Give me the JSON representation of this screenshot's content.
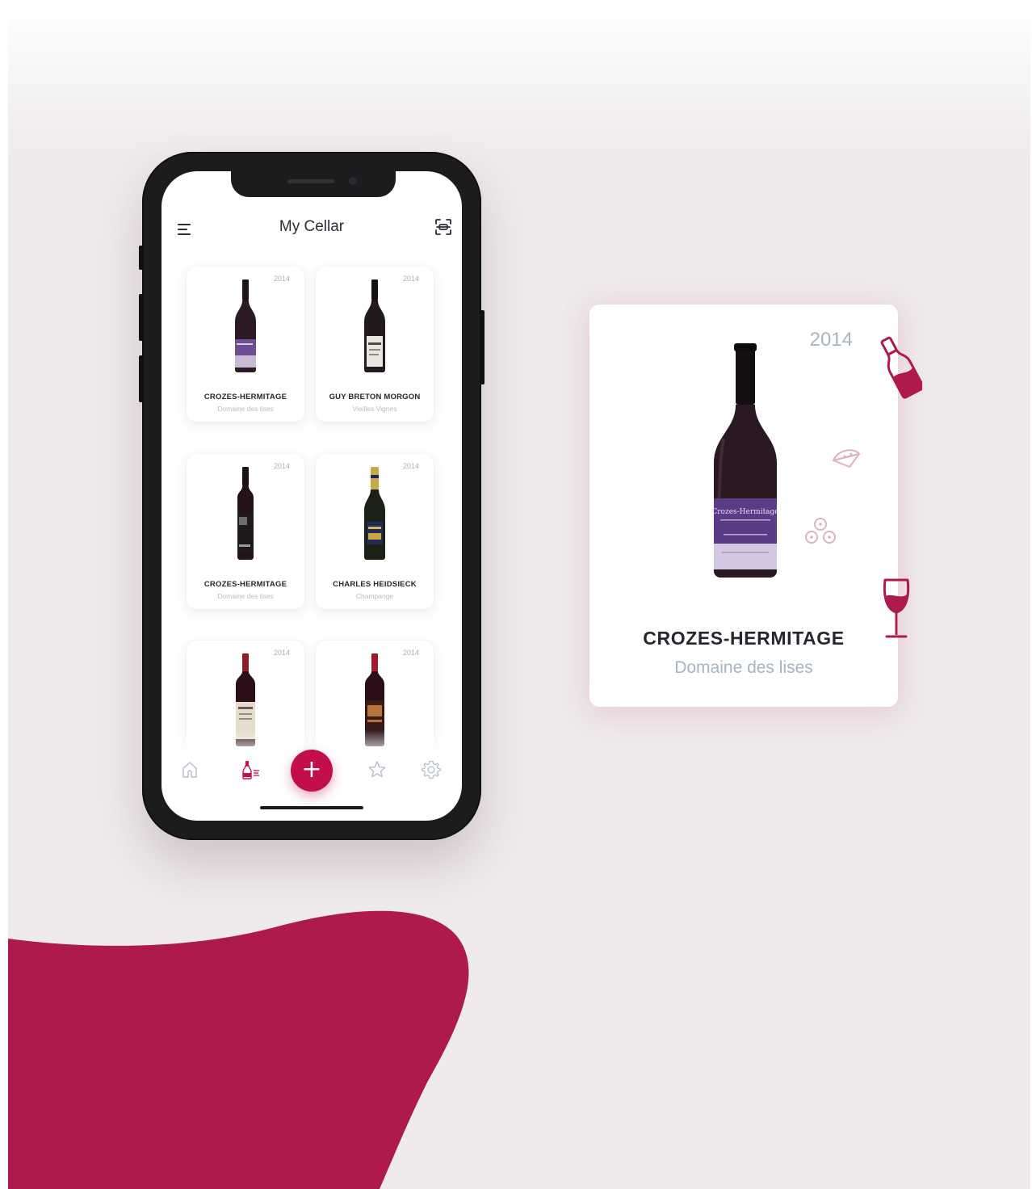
{
  "app": {
    "title": "My Cellar"
  },
  "colors": {
    "accent": "#c20f49",
    "blob": "#ad1a4b",
    "background": "#efeaec"
  },
  "wines": [
    {
      "year": "2014",
      "name": "CROZES-HERMITAGE",
      "subtitle": "Domaine des lises",
      "bottle": "red-purple-label"
    },
    {
      "year": "2014",
      "name": "GUY BRETON MORGON",
      "subtitle": "Vieilles Vignes",
      "bottle": "red-white-label"
    },
    {
      "year": "2014",
      "name": "CROZES-HERMITAGE",
      "subtitle": "Domaine des lises",
      "bottle": "bordeaux-dark-label"
    },
    {
      "year": "2014",
      "name": "CHARLES HEIDSIECK",
      "subtitle": "Champange",
      "bottle": "champagne-gold-foil"
    },
    {
      "year": "2014",
      "name": "",
      "subtitle": "",
      "bottle": "red-cream-label"
    },
    {
      "year": "2014",
      "name": "",
      "subtitle": "",
      "bottle": "red-copper-label"
    }
  ],
  "tabbar": {
    "items": [
      "home-icon",
      "cellar-list-icon",
      "add-icon",
      "star-icon",
      "settings-icon"
    ],
    "active": "cellar-list-icon",
    "fab_label": "+"
  },
  "detail": {
    "year": "2014",
    "name": "CROZES-HERMITAGE",
    "subtitle": "Domaine des lises",
    "label_text": "Crozes-Hermitage"
  },
  "decor_icons": [
    "wine-bottle-icon",
    "cheese-icon",
    "grapes-icon",
    "wine-glass-icon"
  ]
}
